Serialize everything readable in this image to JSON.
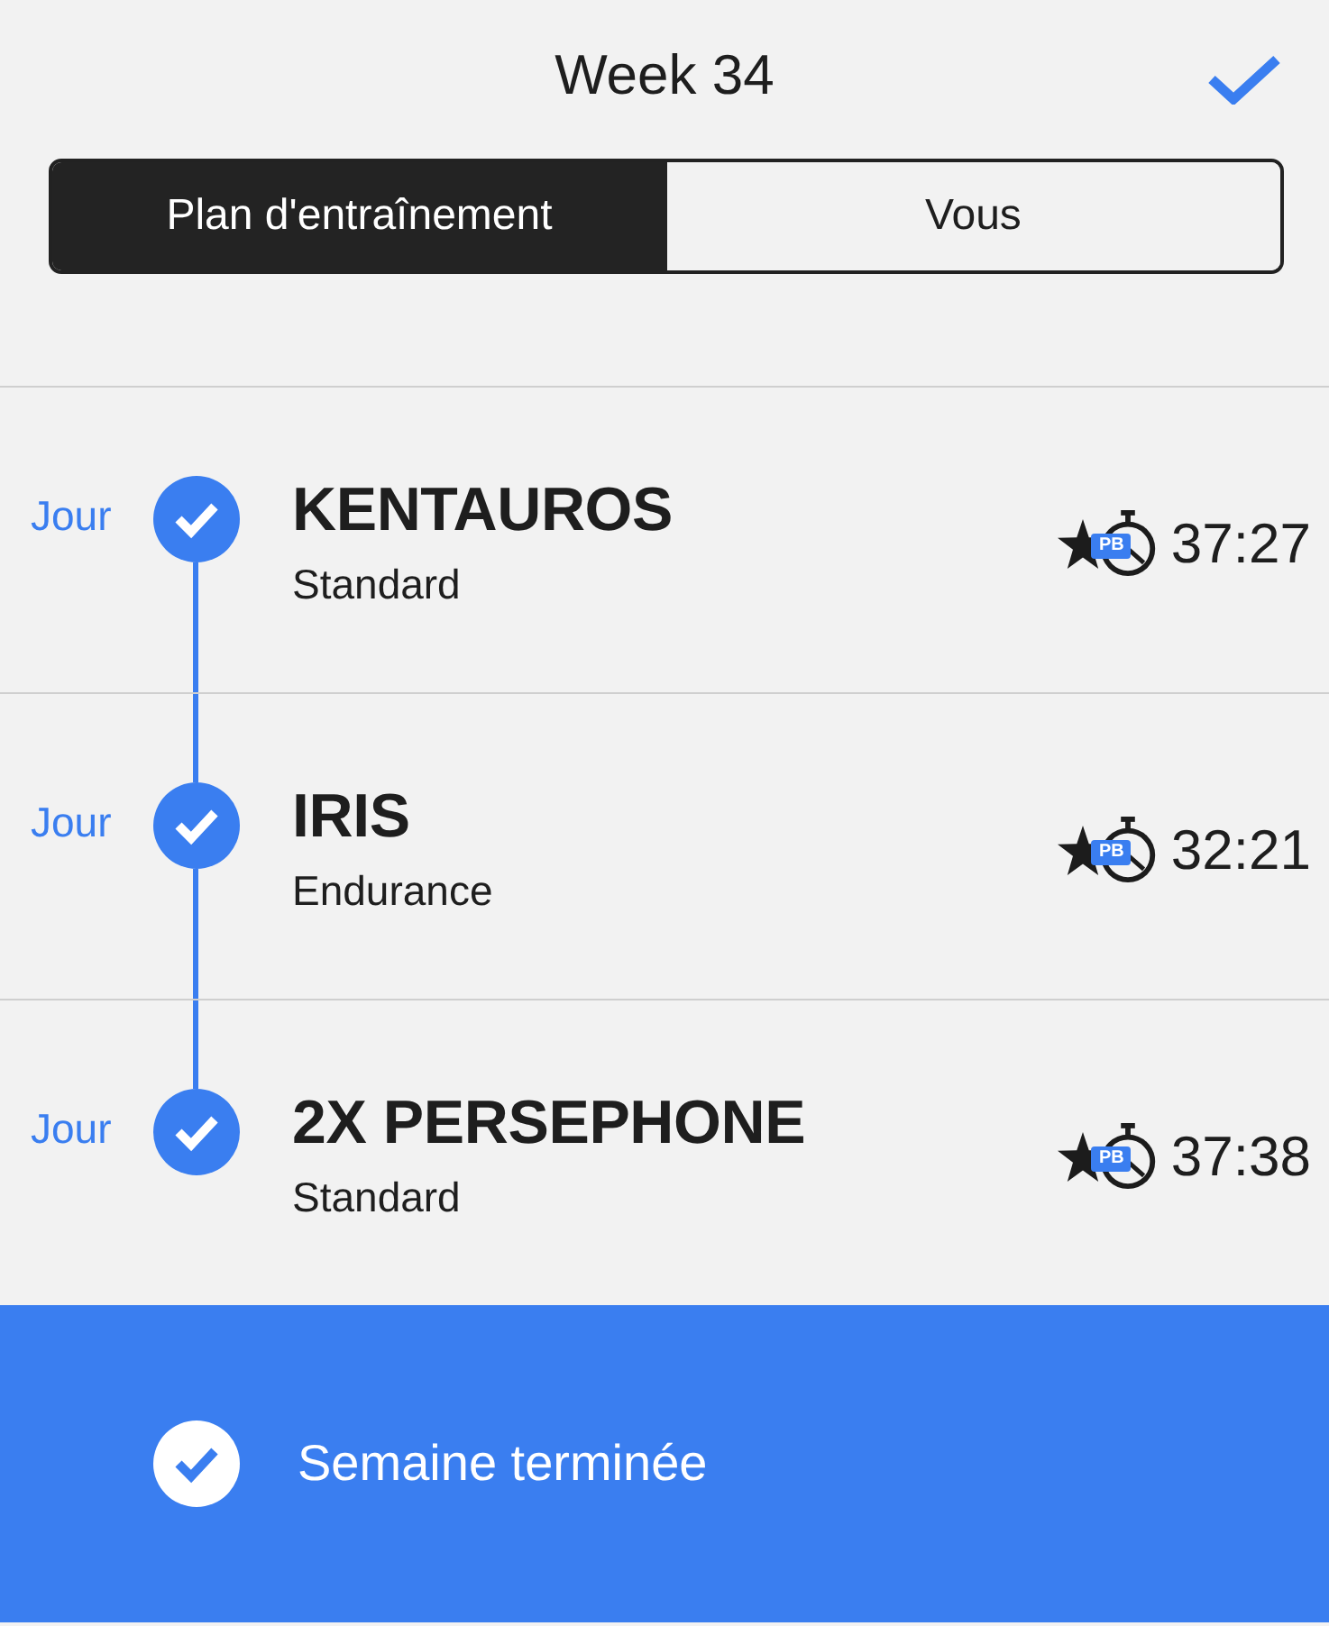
{
  "header": {
    "title": "Week 34"
  },
  "tabs": [
    {
      "label": "Plan d'entraînement",
      "selected": true
    },
    {
      "label": "Vous",
      "selected": false
    }
  ],
  "workouts": [
    {
      "day": "Jour",
      "completed": true,
      "title": "KENTAUROS",
      "subtitle": "Standard",
      "badge": "PB",
      "time": "37:27"
    },
    {
      "day": "Jour",
      "completed": true,
      "title": "IRIS",
      "subtitle": "Endurance",
      "badge": "PB",
      "time": "32:21"
    },
    {
      "day": "Jour",
      "completed": true,
      "title": "2X PERSEPHONE",
      "subtitle": "Standard",
      "badge": "PB",
      "time": "37:38"
    }
  ],
  "footer": {
    "label": "Semaine terminée"
  }
}
